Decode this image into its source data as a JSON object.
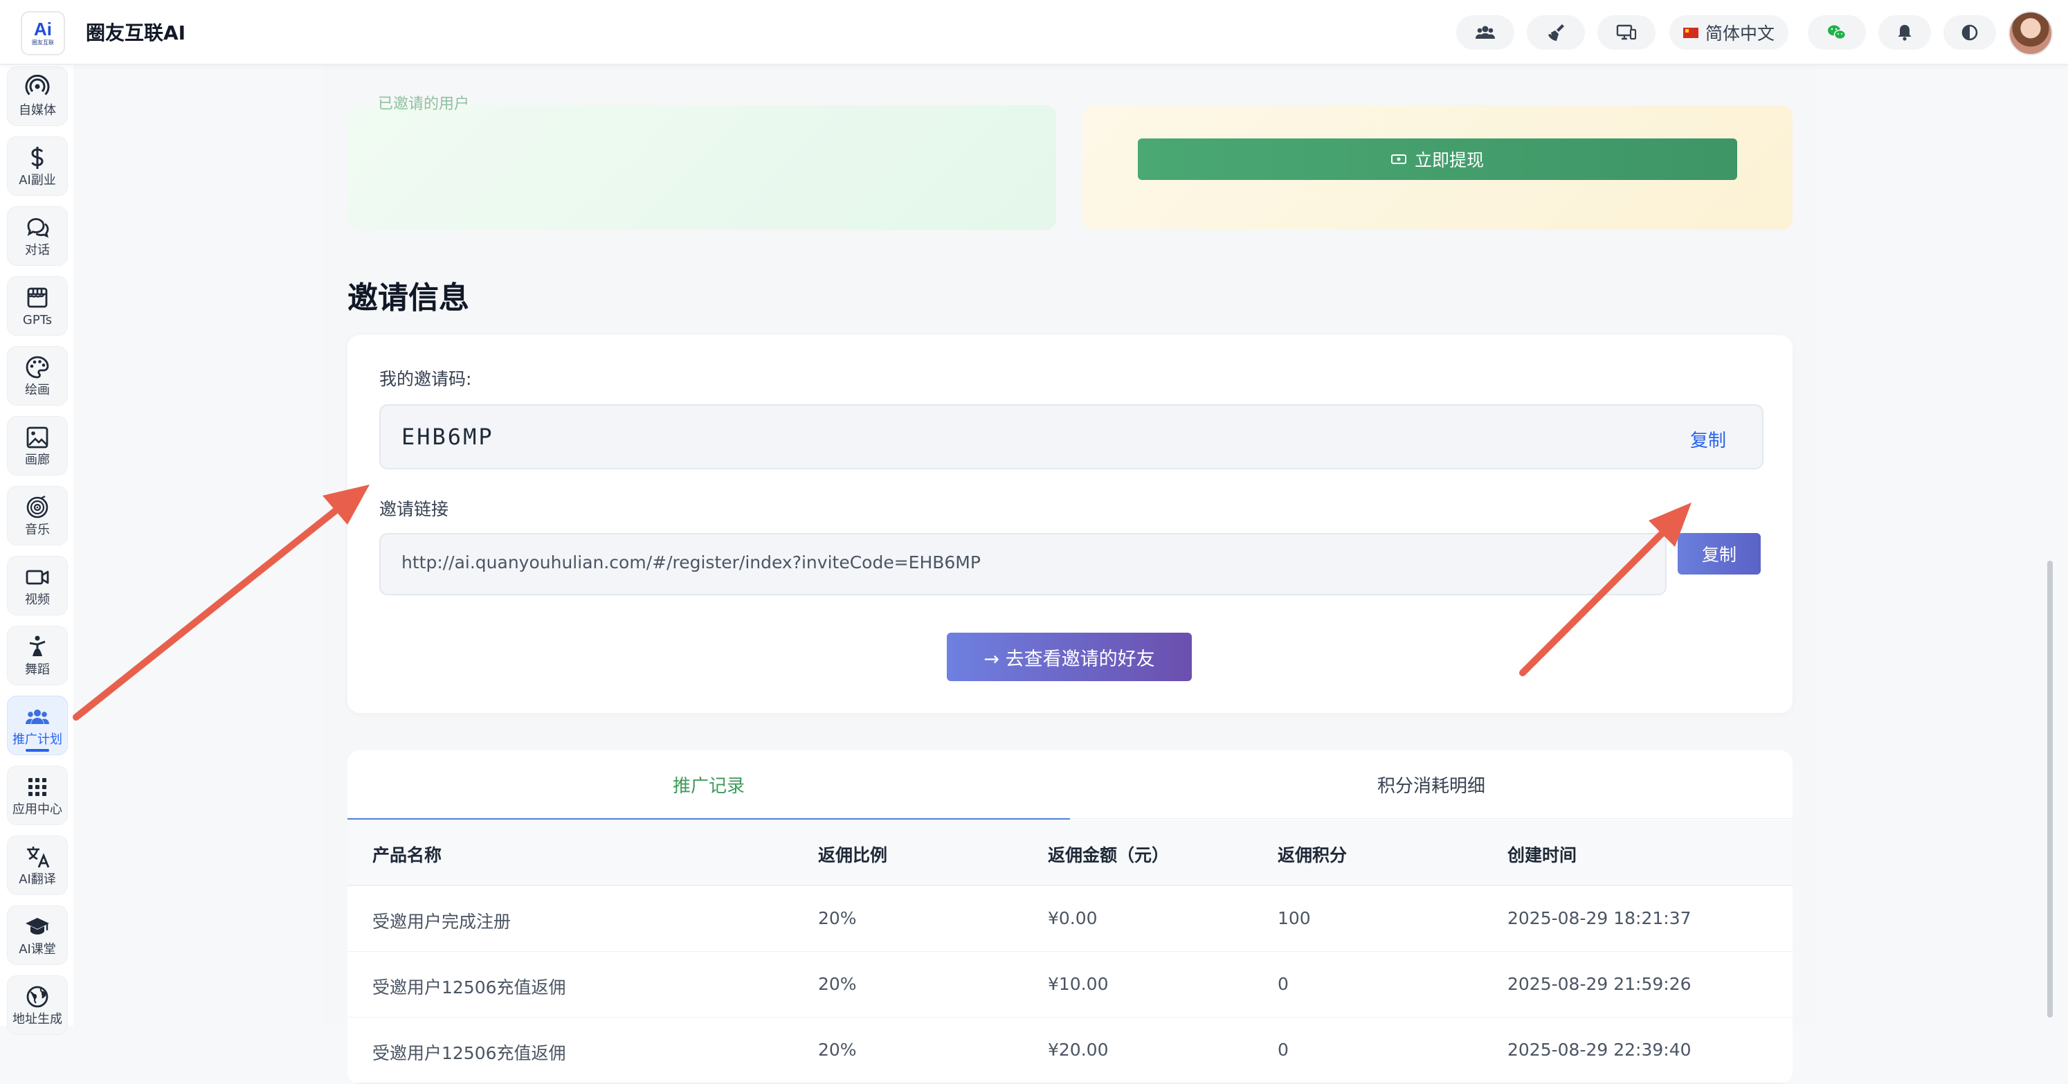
{
  "header": {
    "logo_text": "Ai",
    "logo_sub": "圈友互联",
    "app_title": "圈友互联AI",
    "language": "简体中文",
    "icons": [
      "users-icon",
      "broom-icon",
      "display-icon",
      "wechat-icon",
      "bell-icon",
      "theme-toggle-icon"
    ]
  },
  "sidebar": {
    "items": [
      {
        "label": "自媒体",
        "icon": "broadcast-icon"
      },
      {
        "label": "AI副业",
        "icon": "dollar-icon"
      },
      {
        "label": "对话",
        "icon": "chat-icon"
      },
      {
        "label": "GPTs",
        "icon": "store-icon"
      },
      {
        "label": "绘画",
        "icon": "palette-icon"
      },
      {
        "label": "画廊",
        "icon": "image-icon"
      },
      {
        "label": "音乐",
        "icon": "music-icon"
      },
      {
        "label": "视频",
        "icon": "video-icon"
      },
      {
        "label": "舞蹈",
        "icon": "dance-icon"
      },
      {
        "label": "推广计划",
        "icon": "users-icon",
        "active": true
      },
      {
        "label": "应用中心",
        "icon": "grid-icon"
      },
      {
        "label": "AI翻译",
        "icon": "translate-icon"
      },
      {
        "label": "AI课堂",
        "icon": "graduation-icon"
      },
      {
        "label": "地址生成",
        "icon": "globe-icon"
      }
    ]
  },
  "top_cards": {
    "green_text": "已邀请的用户",
    "withdraw_label": "立即提现"
  },
  "invite": {
    "section_title": "邀请信息",
    "code_label": "我的邀请码:",
    "code_value": "EHB6MP",
    "code_copy": "复制",
    "link_label": "邀请链接",
    "link_value": "http://ai.quanyouhulian.com/#/register/index?inviteCode=EHB6MP",
    "link_copy": "复制",
    "friends_button": "→ 去查看邀请的好友"
  },
  "records": {
    "tabs": [
      "推广记录",
      "积分消耗明细"
    ],
    "columns": [
      "产品名称",
      "返佣比例",
      "返佣金额（元）",
      "返佣积分",
      "创建时间"
    ],
    "rows": [
      [
        "受邀用户完成注册",
        "20%",
        "¥0.00",
        "100",
        "2025-08-29 18:21:37"
      ],
      [
        "受邀用户12506充值返佣",
        "20%",
        "¥10.00",
        "0",
        "2025-08-29 21:59:26"
      ],
      [
        "受邀用户12506充值返佣",
        "20%",
        "¥20.00",
        "0",
        "2025-08-29 22:39:40"
      ]
    ]
  },
  "colors": {
    "accent_blue": "#2563eb",
    "green_button": "#4aa873",
    "annotation_arrow": "#e8604c",
    "purple_button": "#5b62c6"
  }
}
